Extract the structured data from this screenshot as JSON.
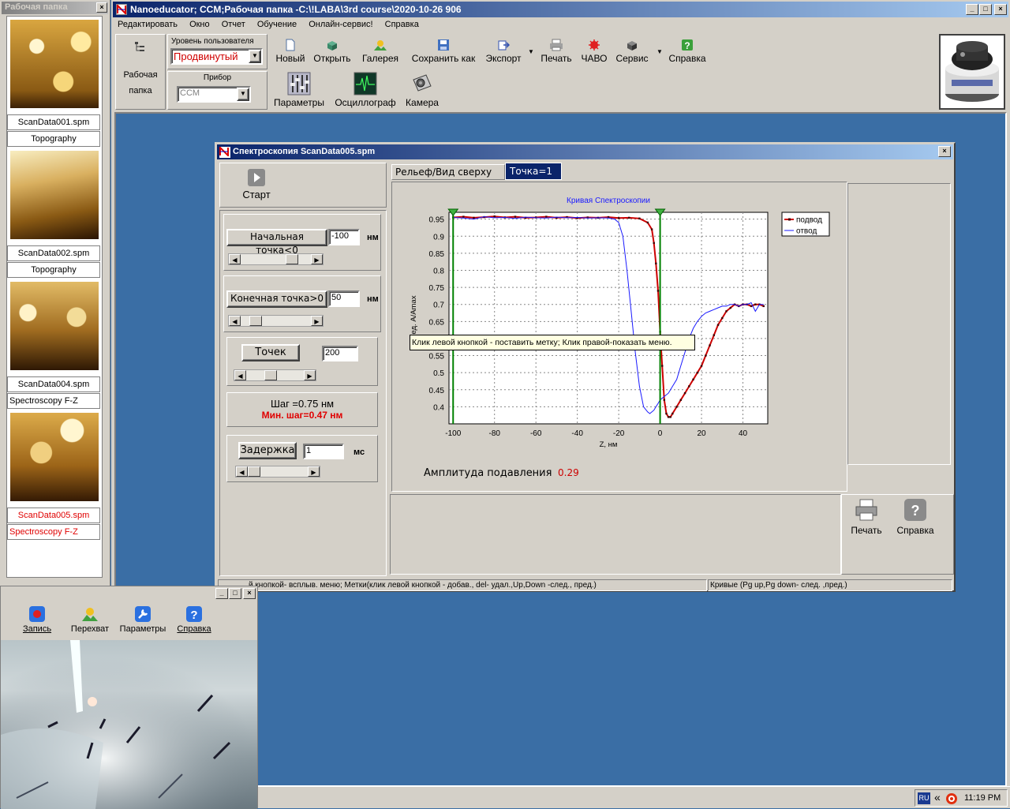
{
  "folder_panel": {
    "title": "Рабочая папка",
    "close": "×",
    "items": [
      {
        "name": "ScanData001.spm",
        "type": "Topography",
        "active": false
      },
      {
        "name": "ScanData002.spm",
        "type": "Topography",
        "active": false
      },
      {
        "name": "ScanData004.spm",
        "type": "Spectroscopy F-Z",
        "active": false
      },
      {
        "name": "ScanData005.spm",
        "type": "Spectroscopy F-Z",
        "active": true
      }
    ]
  },
  "main_window": {
    "title": "Nanoeducator; CCM;Рабочая папка -C:\\!LABA\\3rd course\\2020-10-26 906",
    "menu": [
      "Редактировать",
      "Окно",
      "Отчет",
      "Обучение",
      "Онлайн-сервис!",
      "Справка"
    ],
    "folder_button": {
      "line1": "Рабочая",
      "line2": "папка"
    },
    "user_level_label": "Уровень пользователя",
    "user_level_value": "Продвинутый",
    "device_label": "Прибор",
    "device_value": "CCM",
    "toolbar": [
      "Новый",
      "Открыть",
      "Галерея",
      "Сохранить как",
      "Экспорт",
      "Печать",
      "ЧАВО",
      "Сервис",
      "Справка"
    ],
    "toolbar2": [
      "Параметры",
      "Осциллограф",
      "Камера"
    ]
  },
  "spectro_window": {
    "title": "Спектроскопия ScanData005.spm",
    "start_label": "Старт",
    "start_point": {
      "label": "Начальная точка<0",
      "value": "-100",
      "unit": "нм",
      "slider": 0.78
    },
    "end_point": {
      "label": "Конечная точка>0",
      "value": "50",
      "unit": "нм",
      "slider": 0.15
    },
    "points": {
      "label": "Точек",
      "value": "200",
      "slider": 0.4
    },
    "step": "Шаг =0.75 нм",
    "min_step": "Мин. шаг=0.47 нм",
    "delay": {
      "label": "Задержка",
      "value": "1",
      "unit": "мс",
      "slider": 0.0
    },
    "tabs": [
      "Рельеф/Вид сверху",
      "Точка=1"
    ],
    "amplitude_label": "Амплитуда подавления",
    "amplitude_value": "0.29",
    "tooltip": "Клик левой кнопкой - поставить метку; Клик правой-показать меню.",
    "print_label": "Печать",
    "help_label": "Справка",
    "status_left": "й кнопкой-  всплыв. меню; Метки(клик левой кнопкой - добав., del- удал.,Up,Down -след., пред.)",
    "status_right": "Кривые (Pg up,Pg down- след. ,пред.)"
  },
  "camera_window": {
    "toolbar": [
      "Запись",
      "Перехват",
      "Параметры",
      "Справка"
    ]
  },
  "taskbar": {
    "lang": "RU",
    "chevron": "«",
    "time": "11:19 PM"
  },
  "colors": {
    "approach": "#cc0000",
    "retract": "#1a1aff",
    "marker": "#008000",
    "chart_title": "#1a1aff",
    "warning_red": "#e00000"
  },
  "chart_data": {
    "type": "line",
    "title": "Кривая Спектроскопии",
    "xlabel": "Z, нм",
    "ylabel": "ед. A/Amax",
    "xlim": [
      -102,
      52
    ],
    "ylim": [
      0.35,
      0.97
    ],
    "xticks": [
      -100,
      -80,
      -60,
      -40,
      -20,
      0,
      20,
      40
    ],
    "yticks": [
      0.95,
      0.9,
      0.85,
      0.8,
      0.75,
      0.7,
      0.65,
      0.6,
      0.55,
      0.5,
      0.45,
      0.4
    ],
    "grid": true,
    "legend_position": "top-right",
    "markers_x": [
      -100,
      0
    ],
    "series": [
      {
        "name": "подвод",
        "color": "#cc0000",
        "markers": true,
        "x": [
          -100,
          -95,
          -90,
          -85,
          -80,
          -75,
          -70,
          -65,
          -60,
          -55,
          -50,
          -45,
          -40,
          -35,
          -30,
          -25,
          -20,
          -15,
          -10,
          -6,
          -4,
          -3,
          -2,
          -1,
          0,
          1,
          2,
          3,
          4,
          5,
          6,
          8,
          10,
          12,
          14,
          16,
          18,
          20,
          22,
          24,
          26,
          28,
          30,
          32,
          34,
          36,
          38,
          40,
          42,
          44,
          46,
          48,
          50
        ],
        "y": [
          0.955,
          0.957,
          0.954,
          0.956,
          0.958,
          0.955,
          0.957,
          0.954,
          0.955,
          0.957,
          0.954,
          0.956,
          0.953,
          0.955,
          0.954,
          0.956,
          0.953,
          0.954,
          0.952,
          0.94,
          0.92,
          0.88,
          0.82,
          0.74,
          0.62,
          0.52,
          0.42,
          0.38,
          0.37,
          0.37,
          0.38,
          0.4,
          0.42,
          0.44,
          0.46,
          0.48,
          0.5,
          0.52,
          0.55,
          0.58,
          0.61,
          0.64,
          0.66,
          0.68,
          0.69,
          0.7,
          0.695,
          0.7,
          0.7,
          0.695,
          0.7,
          0.7,
          0.695
        ]
      },
      {
        "name": "отвод",
        "color": "#1a1aff",
        "markers": false,
        "x": [
          -100,
          -95,
          -90,
          -85,
          -80,
          -75,
          -70,
          -65,
          -60,
          -55,
          -50,
          -45,
          -40,
          -35,
          -30,
          -25,
          -22,
          -20,
          -18,
          -16,
          -14,
          -12,
          -10,
          -8,
          -6,
          -5,
          -4,
          -3,
          -2,
          -1,
          0,
          2,
          4,
          6,
          8,
          10,
          12,
          14,
          16,
          18,
          20,
          22,
          24,
          26,
          28,
          30,
          32,
          34,
          36,
          38,
          40,
          42,
          44,
          46,
          48,
          50
        ],
        "y": [
          0.955,
          0.953,
          0.95,
          0.957,
          0.954,
          0.955,
          0.952,
          0.956,
          0.954,
          0.953,
          0.956,
          0.954,
          0.955,
          0.953,
          0.954,
          0.953,
          0.95,
          0.94,
          0.9,
          0.8,
          0.68,
          0.56,
          0.46,
          0.4,
          0.385,
          0.38,
          0.385,
          0.39,
          0.4,
          0.41,
          0.42,
          0.43,
          0.44,
          0.46,
          0.48,
          0.52,
          0.56,
          0.6,
          0.63,
          0.65,
          0.665,
          0.675,
          0.68,
          0.685,
          0.69,
          0.695,
          0.695,
          0.7,
          0.7,
          0.695,
          0.7,
          0.7,
          0.705,
          0.68,
          0.7,
          0.7
        ]
      }
    ]
  }
}
